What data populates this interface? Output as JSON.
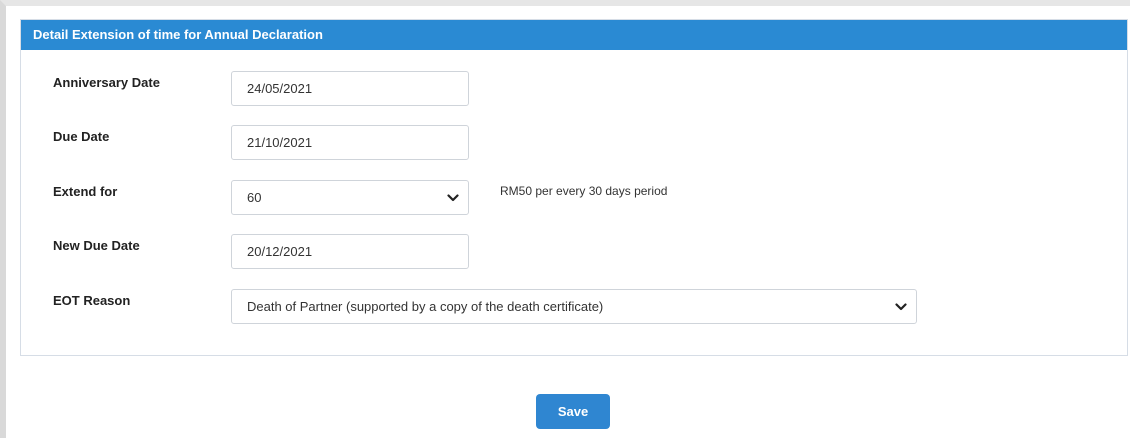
{
  "panel": {
    "title": "Detail Extension of time for Annual Declaration"
  },
  "form": {
    "anniversary_date": {
      "label": "Anniversary Date",
      "value": "24/05/2021"
    },
    "due_date": {
      "label": "Due Date",
      "value": "21/10/2021"
    },
    "extend_for": {
      "label": "Extend for",
      "value": "60",
      "hint": "RM50 per every 30 days period"
    },
    "new_due_date": {
      "label": "New Due Date",
      "value": "20/12/2021"
    },
    "eot_reason": {
      "label": "EOT Reason",
      "value": "Death of Partner (supported by a copy of the death certificate)"
    }
  },
  "actions": {
    "save_label": "Save"
  },
  "icons": {
    "dropdown": "chevron-down-icon"
  },
  "colors": {
    "header": "#2a8ad3",
    "save_button": "#2f86d1"
  }
}
